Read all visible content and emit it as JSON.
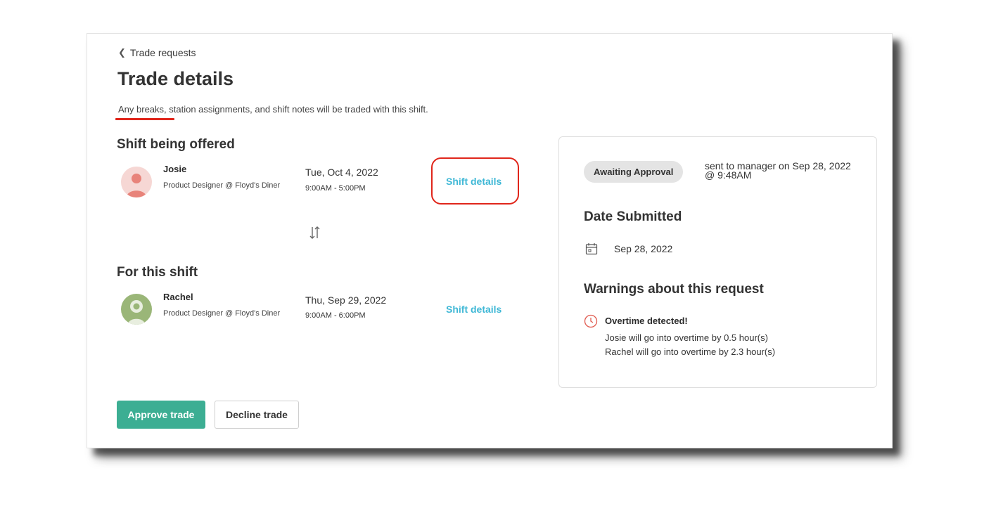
{
  "breadcrumb": {
    "label": "Trade requests"
  },
  "page": {
    "title": "Trade details",
    "subtitle": "Any breaks, station assignments, and shift notes will be traded with this shift."
  },
  "offered": {
    "section_title": "Shift being offered",
    "name": "Josie",
    "role": "Product Designer @ Floyd's Diner",
    "date": "Tue, Oct 4, 2022",
    "time": "9:00AM - 5:00PM",
    "link_label": "Shift details"
  },
  "target": {
    "section_title": "For this shift",
    "name": "Rachel",
    "role": "Product Designer @ Floyd's Diner",
    "date": "Thu, Sep 29, 2022",
    "time": "9:00AM - 6:00PM",
    "link_label": "Shift details"
  },
  "actions": {
    "approve_label": "Approve trade",
    "decline_label": "Decline trade"
  },
  "status": {
    "badge": "Awaiting Approval",
    "sent_text": "sent to manager on Sep 28, 2022 @ 9:48AM"
  },
  "submitted": {
    "heading": "Date Submitted",
    "date": "Sep 28, 2022"
  },
  "warnings": {
    "heading": "Warnings about this request",
    "title": "Overtime detected!",
    "lines": [
      "Josie will go into overtime by 0.5 hour(s)",
      "Rachel will go into overtime by 2.3 hour(s)"
    ]
  },
  "colors": {
    "accent_green": "#3cae93",
    "link_blue": "#3fb8d6",
    "annotation_red": "#e0261b",
    "avatar_josie_bg": "#f6d7d4",
    "avatar_josie_fg": "#e8837a",
    "avatar_rachel_bg": "#9ab678"
  },
  "icons": {
    "back": "chevron-left-icon",
    "swap": "swap-vertical-icon",
    "calendar": "calendar-icon",
    "warning": "clock-warning-icon"
  }
}
